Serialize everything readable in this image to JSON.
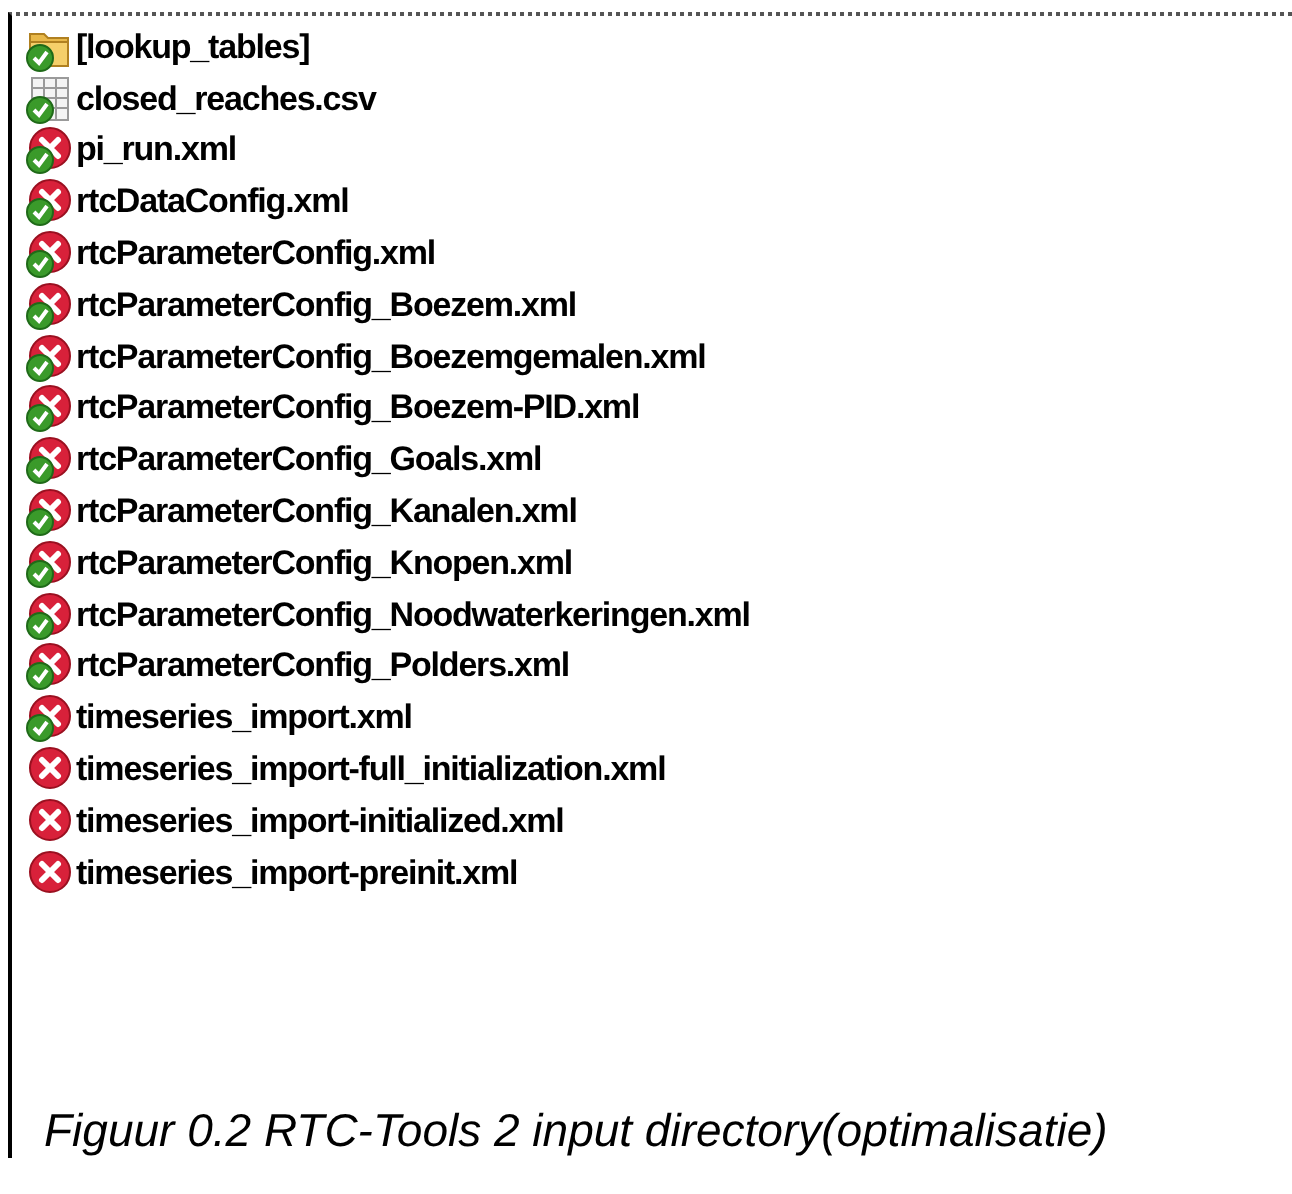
{
  "files": [
    {
      "name": "[lookup_tables]",
      "kind": "folder",
      "checked": true
    },
    {
      "name": "closed_reaches.csv",
      "kind": "csv",
      "checked": true
    },
    {
      "name": "pi_run.xml",
      "kind": "xml",
      "checked": true
    },
    {
      "name": "rtcDataConfig.xml",
      "kind": "xml",
      "checked": true
    },
    {
      "name": "rtcParameterConfig.xml",
      "kind": "xml",
      "checked": true
    },
    {
      "name": "rtcParameterConfig_Boezem.xml",
      "kind": "xml",
      "checked": true
    },
    {
      "name": "rtcParameterConfig_Boezemgemalen.xml",
      "kind": "xml",
      "checked": true
    },
    {
      "name": "rtcParameterConfig_Boezem-PID.xml",
      "kind": "xml",
      "checked": true
    },
    {
      "name": "rtcParameterConfig_Goals.xml",
      "kind": "xml",
      "checked": true
    },
    {
      "name": "rtcParameterConfig_Kanalen.xml",
      "kind": "xml",
      "checked": true
    },
    {
      "name": "rtcParameterConfig_Knopen.xml",
      "kind": "xml",
      "checked": true
    },
    {
      "name": "rtcParameterConfig_Noodwaterkeringen.xml",
      "kind": "xml",
      "checked": true
    },
    {
      "name": "rtcParameterConfig_Polders.xml",
      "kind": "xml",
      "checked": true
    },
    {
      "name": "timeseries_import.xml",
      "kind": "xml",
      "checked": true
    },
    {
      "name": "timeseries_import-full_initialization.xml",
      "kind": "xml",
      "checked": false
    },
    {
      "name": "timeseries_import-initialized.xml",
      "kind": "xml",
      "checked": false
    },
    {
      "name": "timeseries_import-preinit.xml",
      "kind": "xml",
      "checked": false
    }
  ],
  "caption": "Figuur 0.2 RTC-Tools 2 input directory(optimalisatie)"
}
